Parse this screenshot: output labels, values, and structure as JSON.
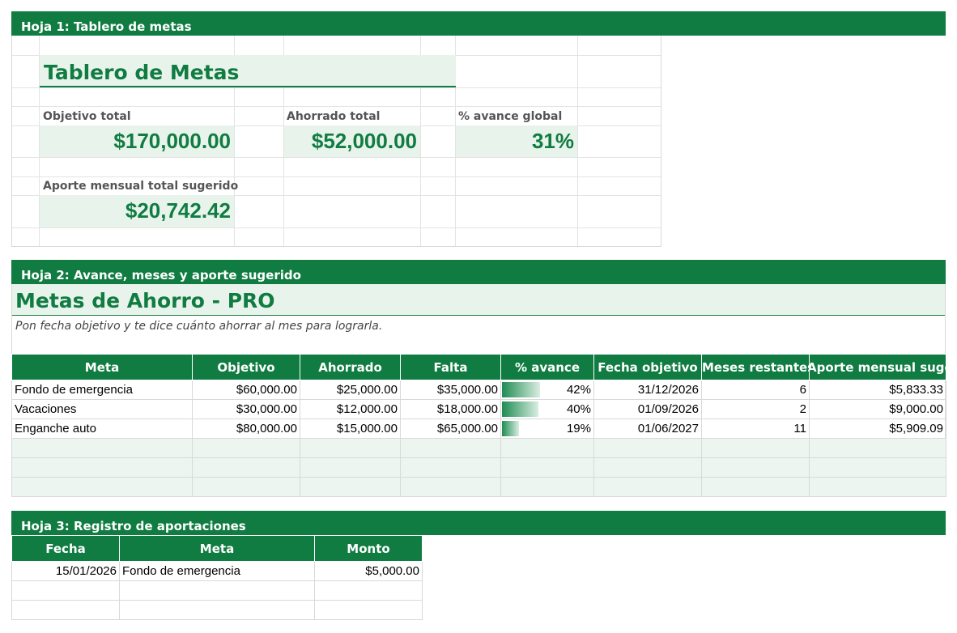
{
  "sheet1": {
    "band": "Hoja 1: Tablero de metas",
    "title": "Tablero de Metas",
    "kpis": [
      {
        "label": "Objetivo total",
        "value": "$170,000.00"
      },
      {
        "label": "Ahorrado total",
        "value": "$52,000.00"
      },
      {
        "label": "% avance global",
        "value": "31%"
      },
      {
        "label": "Aporte mensual total sugerido",
        "value": "$20,742.42"
      }
    ]
  },
  "sheet2": {
    "band": "Hoja 2: Avance, meses y aporte sugerido",
    "title": "Metas de Ahorro - PRO",
    "subtitle": "Pon fecha objetivo y te dice cuánto ahorrar al mes para lograrla.",
    "headers": [
      "Meta",
      "Objetivo",
      "Ahorrado",
      "Falta",
      "% avance",
      "Fecha objetivo",
      "Meses restantes",
      "Aporte mensual sugerido"
    ],
    "rows": [
      {
        "meta": "Fondo de emergencia",
        "objetivo": "$60,000.00",
        "ahorrado": "$25,000.00",
        "falta": "$35,000.00",
        "avance": "42%",
        "avance_frac": 0.42,
        "fecha": "31/12/2026",
        "meses": "6",
        "aporte": "$5,833.33"
      },
      {
        "meta": "Vacaciones",
        "objetivo": "$30,000.00",
        "ahorrado": "$12,000.00",
        "falta": "$18,000.00",
        "avance": "40%",
        "avance_frac": 0.4,
        "fecha": "01/09/2026",
        "meses": "2",
        "aporte": "$9,000.00"
      },
      {
        "meta": "Enganche auto",
        "objetivo": "$80,000.00",
        "ahorrado": "$15,000.00",
        "falta": "$65,000.00",
        "avance": "19%",
        "avance_frac": 0.19,
        "fecha": "01/06/2027",
        "meses": "11",
        "aporte": "$5,909.09"
      }
    ]
  },
  "sheet3": {
    "band": "Hoja 3: Registro de aportaciones",
    "headers": [
      "Fecha",
      "Meta",
      "Monto"
    ],
    "rows": [
      {
        "fecha": "15/01/2026",
        "meta": "Fondo de emergencia",
        "monto": "$5,000.00"
      }
    ]
  },
  "colors": {
    "accent": "#107c41",
    "light_fill": "#e8f3ec"
  }
}
